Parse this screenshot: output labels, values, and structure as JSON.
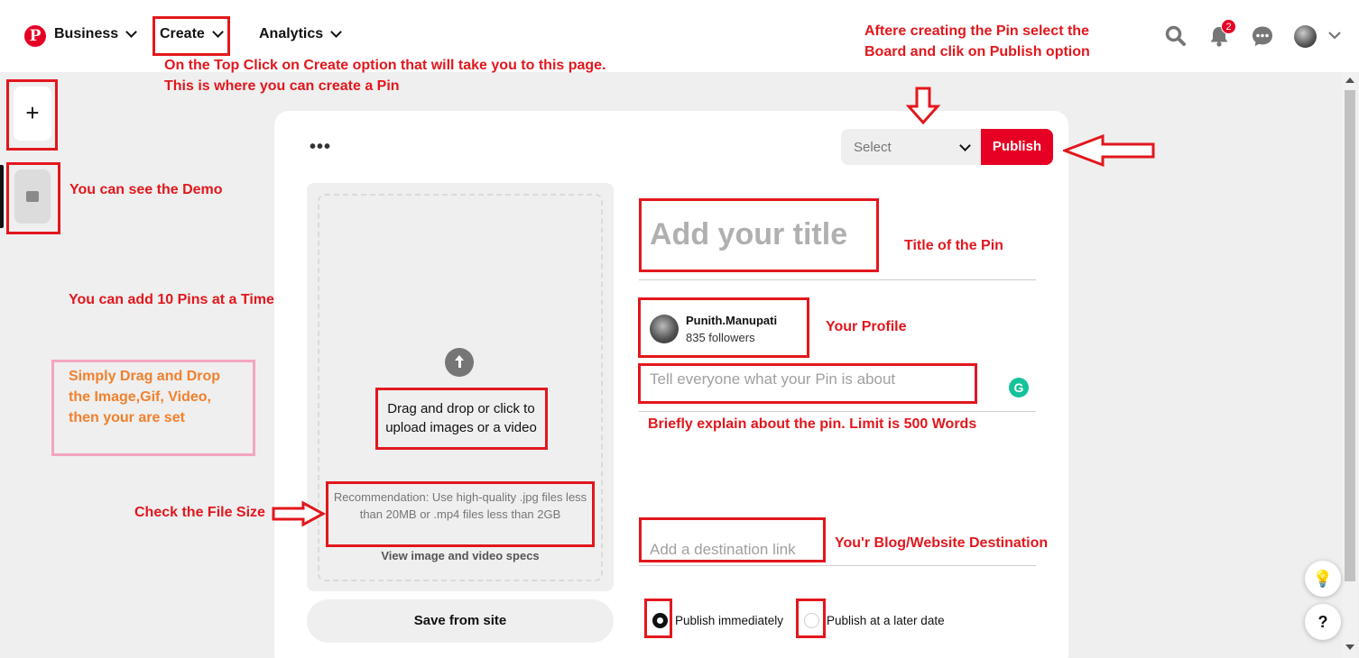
{
  "nav": {
    "logo": "P",
    "business": "Business",
    "create": "Create",
    "analytics": "Analytics",
    "notification_count": "2"
  },
  "sidebar": {
    "add_label": "+"
  },
  "editor": {
    "more_label": "•••",
    "board_select": "Select",
    "publish_label": "Publish",
    "upload_text": "Drag and drop or click to upload images or a video",
    "recommendation": "Recommendation: Use high-quality .jpg files less than 20MB or .mp4 files less than 2GB",
    "specs_link": "View image and video specs",
    "save_from_site": "Save from site",
    "title_placeholder": "Add your title",
    "profile_name": "Punith.Manupati",
    "profile_followers": "835 followers",
    "description_placeholder": "Tell everyone what your Pin is about",
    "link_placeholder": "Add a destination link",
    "radio_immediately": "Publish immediately",
    "radio_later": "Publish at a later date",
    "grammarly_label": "G"
  },
  "help": {
    "tips": "💡",
    "question": "?"
  },
  "annotations": {
    "create_note_1": "On the Top Click on Create option that will take you to this page.",
    "create_note_2": "This is where you can create a Pin",
    "publish_note_1": "Aftere creating the Pin select the",
    "publish_note_2": "Board and clik on Publish option",
    "demo": "You can see the Demo",
    "ten_pins": "You can add 10 Pins at a Time",
    "drag_1": "Simply Drag and Drop",
    "drag_2": "the Image,Gif, Video,",
    "drag_3": "then your are set",
    "file_size": "Check the File Size",
    "title": "Title of the Pin",
    "profile": "Your Profile",
    "description": "Briefly explain about the pin. Limit is 500 Words",
    "destination": "You'r Blog/Website Destination"
  },
  "colors": {
    "brand": "#e60023",
    "annotation": "#e2171d",
    "annotation_orange": "#f2802c",
    "annotation_pink": "#f4a6be"
  }
}
